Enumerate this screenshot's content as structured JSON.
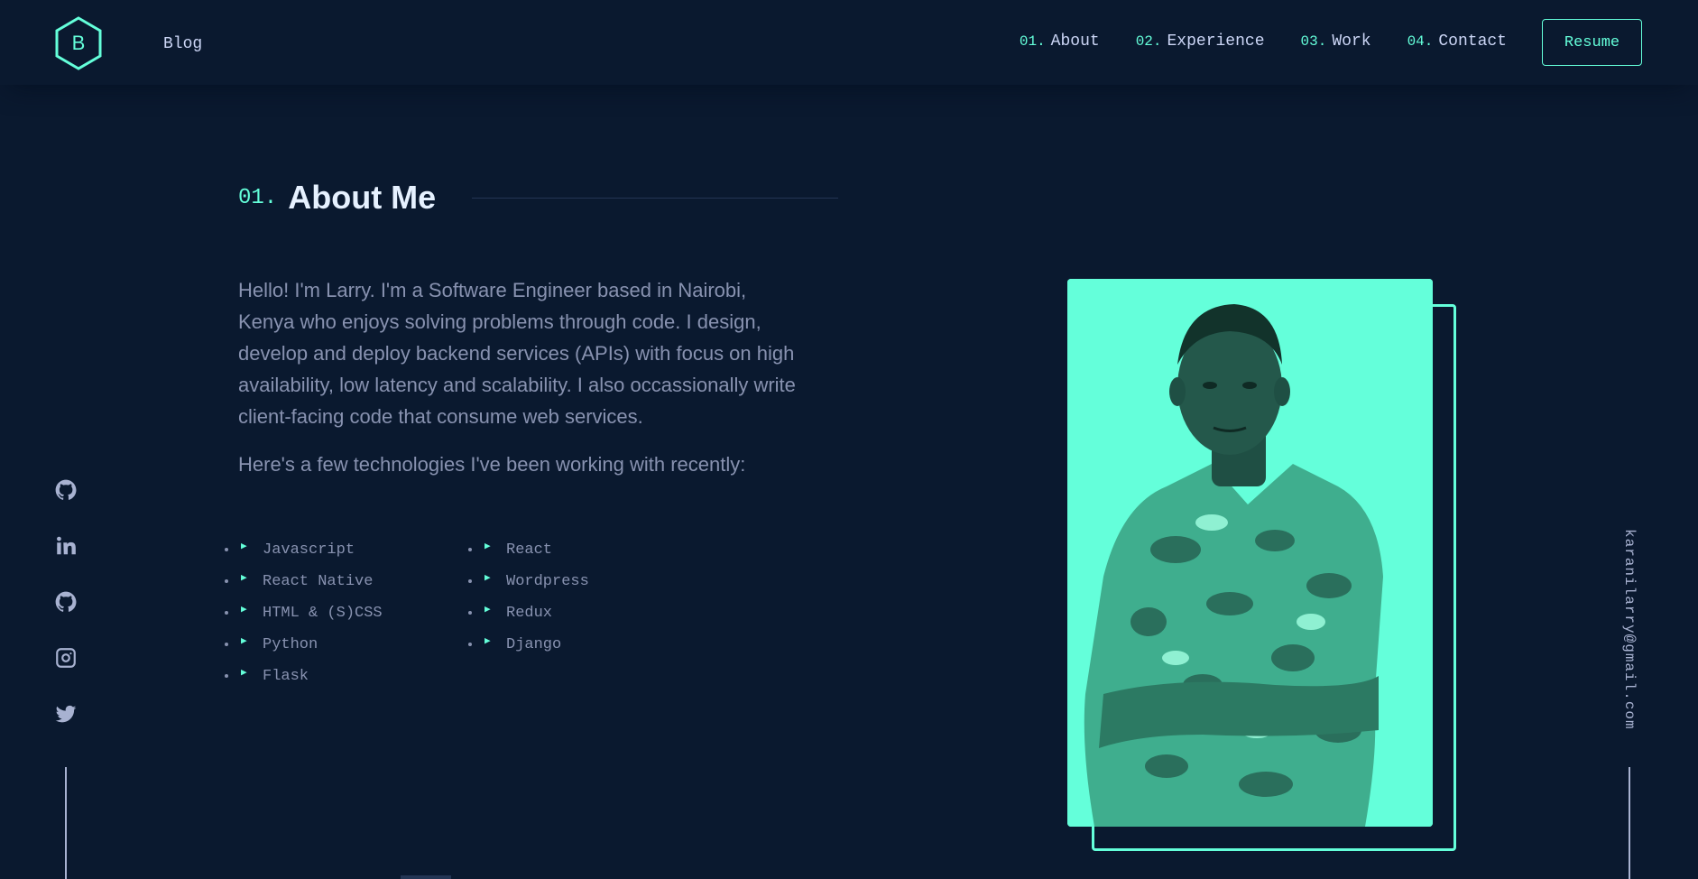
{
  "header": {
    "logo_letter": "B",
    "blog_label": "Blog",
    "nav": [
      {
        "num": "01.",
        "label": "About"
      },
      {
        "num": "02.",
        "label": "Experience"
      },
      {
        "num": "03.",
        "label": "Work"
      },
      {
        "num": "04.",
        "label": "Contact"
      }
    ],
    "resume_label": "Resume"
  },
  "about": {
    "num": "01.",
    "title": "About Me",
    "paragraph": "Hello! I'm Larry. I'm a Software Engineer based in Nairobi, Kenya who enjoys solving problems through code. I design, develop and deploy backend services (APIs) with focus on high availability, low latency and scalability. I also occassionally write client-facing code that consume web services.",
    "tech_intro": "Here's a few technologies I've been working with recently:",
    "technologies": [
      "Javascript",
      "React",
      "React Native",
      "Wordpress",
      "HTML & (S)CSS",
      "Redux",
      "Python",
      "Django",
      "Flask"
    ]
  },
  "social": [
    "github-icon",
    "linkedin-icon",
    "github-icon",
    "instagram-icon",
    "twitter-icon"
  ],
  "email": "karanilarry@gmail.com",
  "colors": {
    "background": "#0a192f",
    "accent": "#64ffda",
    "text": "#8892b0",
    "heading": "#e6f1ff"
  }
}
